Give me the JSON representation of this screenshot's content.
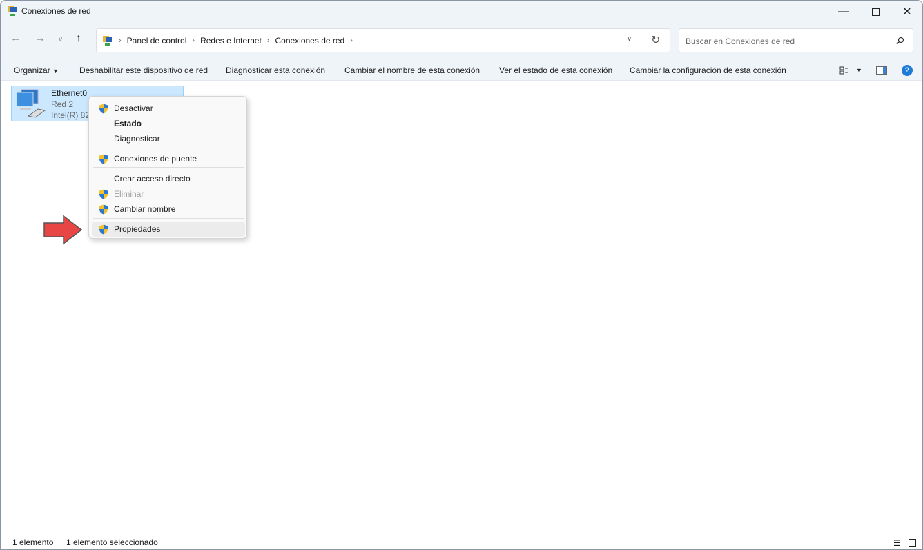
{
  "window": {
    "title": "Conexiones de red"
  },
  "address": {
    "crumbs": [
      "Panel de control",
      "Redes e Internet",
      "Conexiones de red"
    ]
  },
  "search": {
    "placeholder": "Buscar en Conexiones de red"
  },
  "toolbar": {
    "items": [
      "Organizar",
      "Deshabilitar este dispositivo de red",
      "Diagnosticar esta conexión",
      "Cambiar el nombre de esta conexión",
      "Ver el estado de esta conexión",
      "Cambiar la configuración de esta conexión"
    ]
  },
  "connection": {
    "name": "Ethernet0",
    "network": "Red 2",
    "adapter": "Intel(R) 825"
  },
  "context_menu": {
    "items": [
      {
        "label": "Desactivar",
        "shield": true
      },
      {
        "label": "Estado",
        "bold": true
      },
      {
        "label": "Diagnosticar"
      },
      {
        "label": "Conexiones de puente",
        "shield": true
      },
      {
        "label": "Crear acceso directo"
      },
      {
        "label": "Eliminar",
        "shield": true,
        "disabled": true
      },
      {
        "label": "Cambiar nombre",
        "shield": true
      },
      {
        "label": "Propiedades",
        "shield": true,
        "highlighted": true
      }
    ]
  },
  "status": {
    "count": "1 elemento",
    "selected": "1 elemento seleccionado"
  },
  "colors": {
    "accent": "#0067c0",
    "selection": "#cce8ff",
    "arrow": "#e84545"
  }
}
